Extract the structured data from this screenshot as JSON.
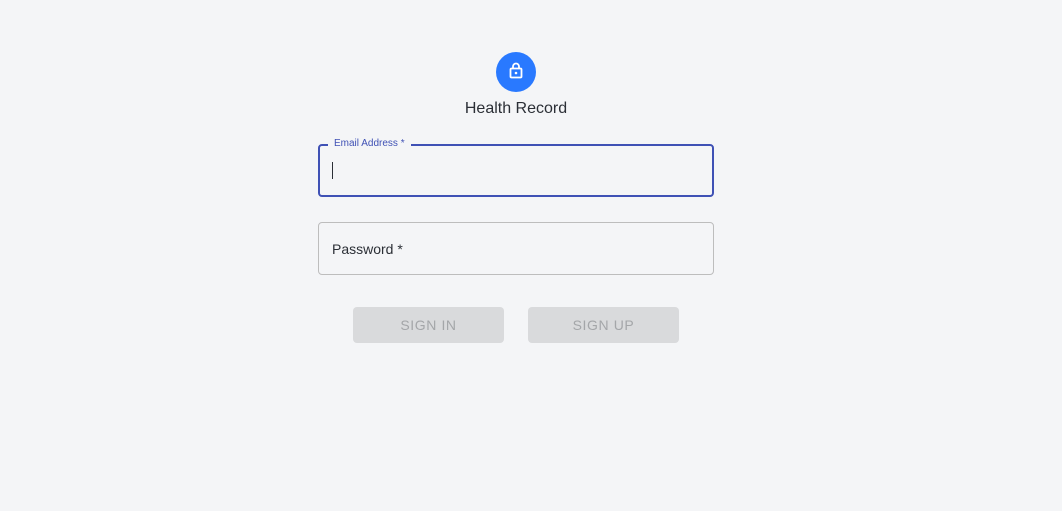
{
  "app": {
    "title": "Health Record",
    "brand_color": "#2979ff",
    "icon": "lock-icon"
  },
  "form": {
    "email": {
      "label": "Email Address *",
      "value": "",
      "placeholder": "",
      "focused": true
    },
    "password": {
      "label": "Password *",
      "value": "",
      "placeholder": ""
    },
    "accent_color": "#3f51b5"
  },
  "actions": {
    "sign_in_label": "Sign In",
    "sign_up_label": "Sign Up",
    "disabled": true
  }
}
